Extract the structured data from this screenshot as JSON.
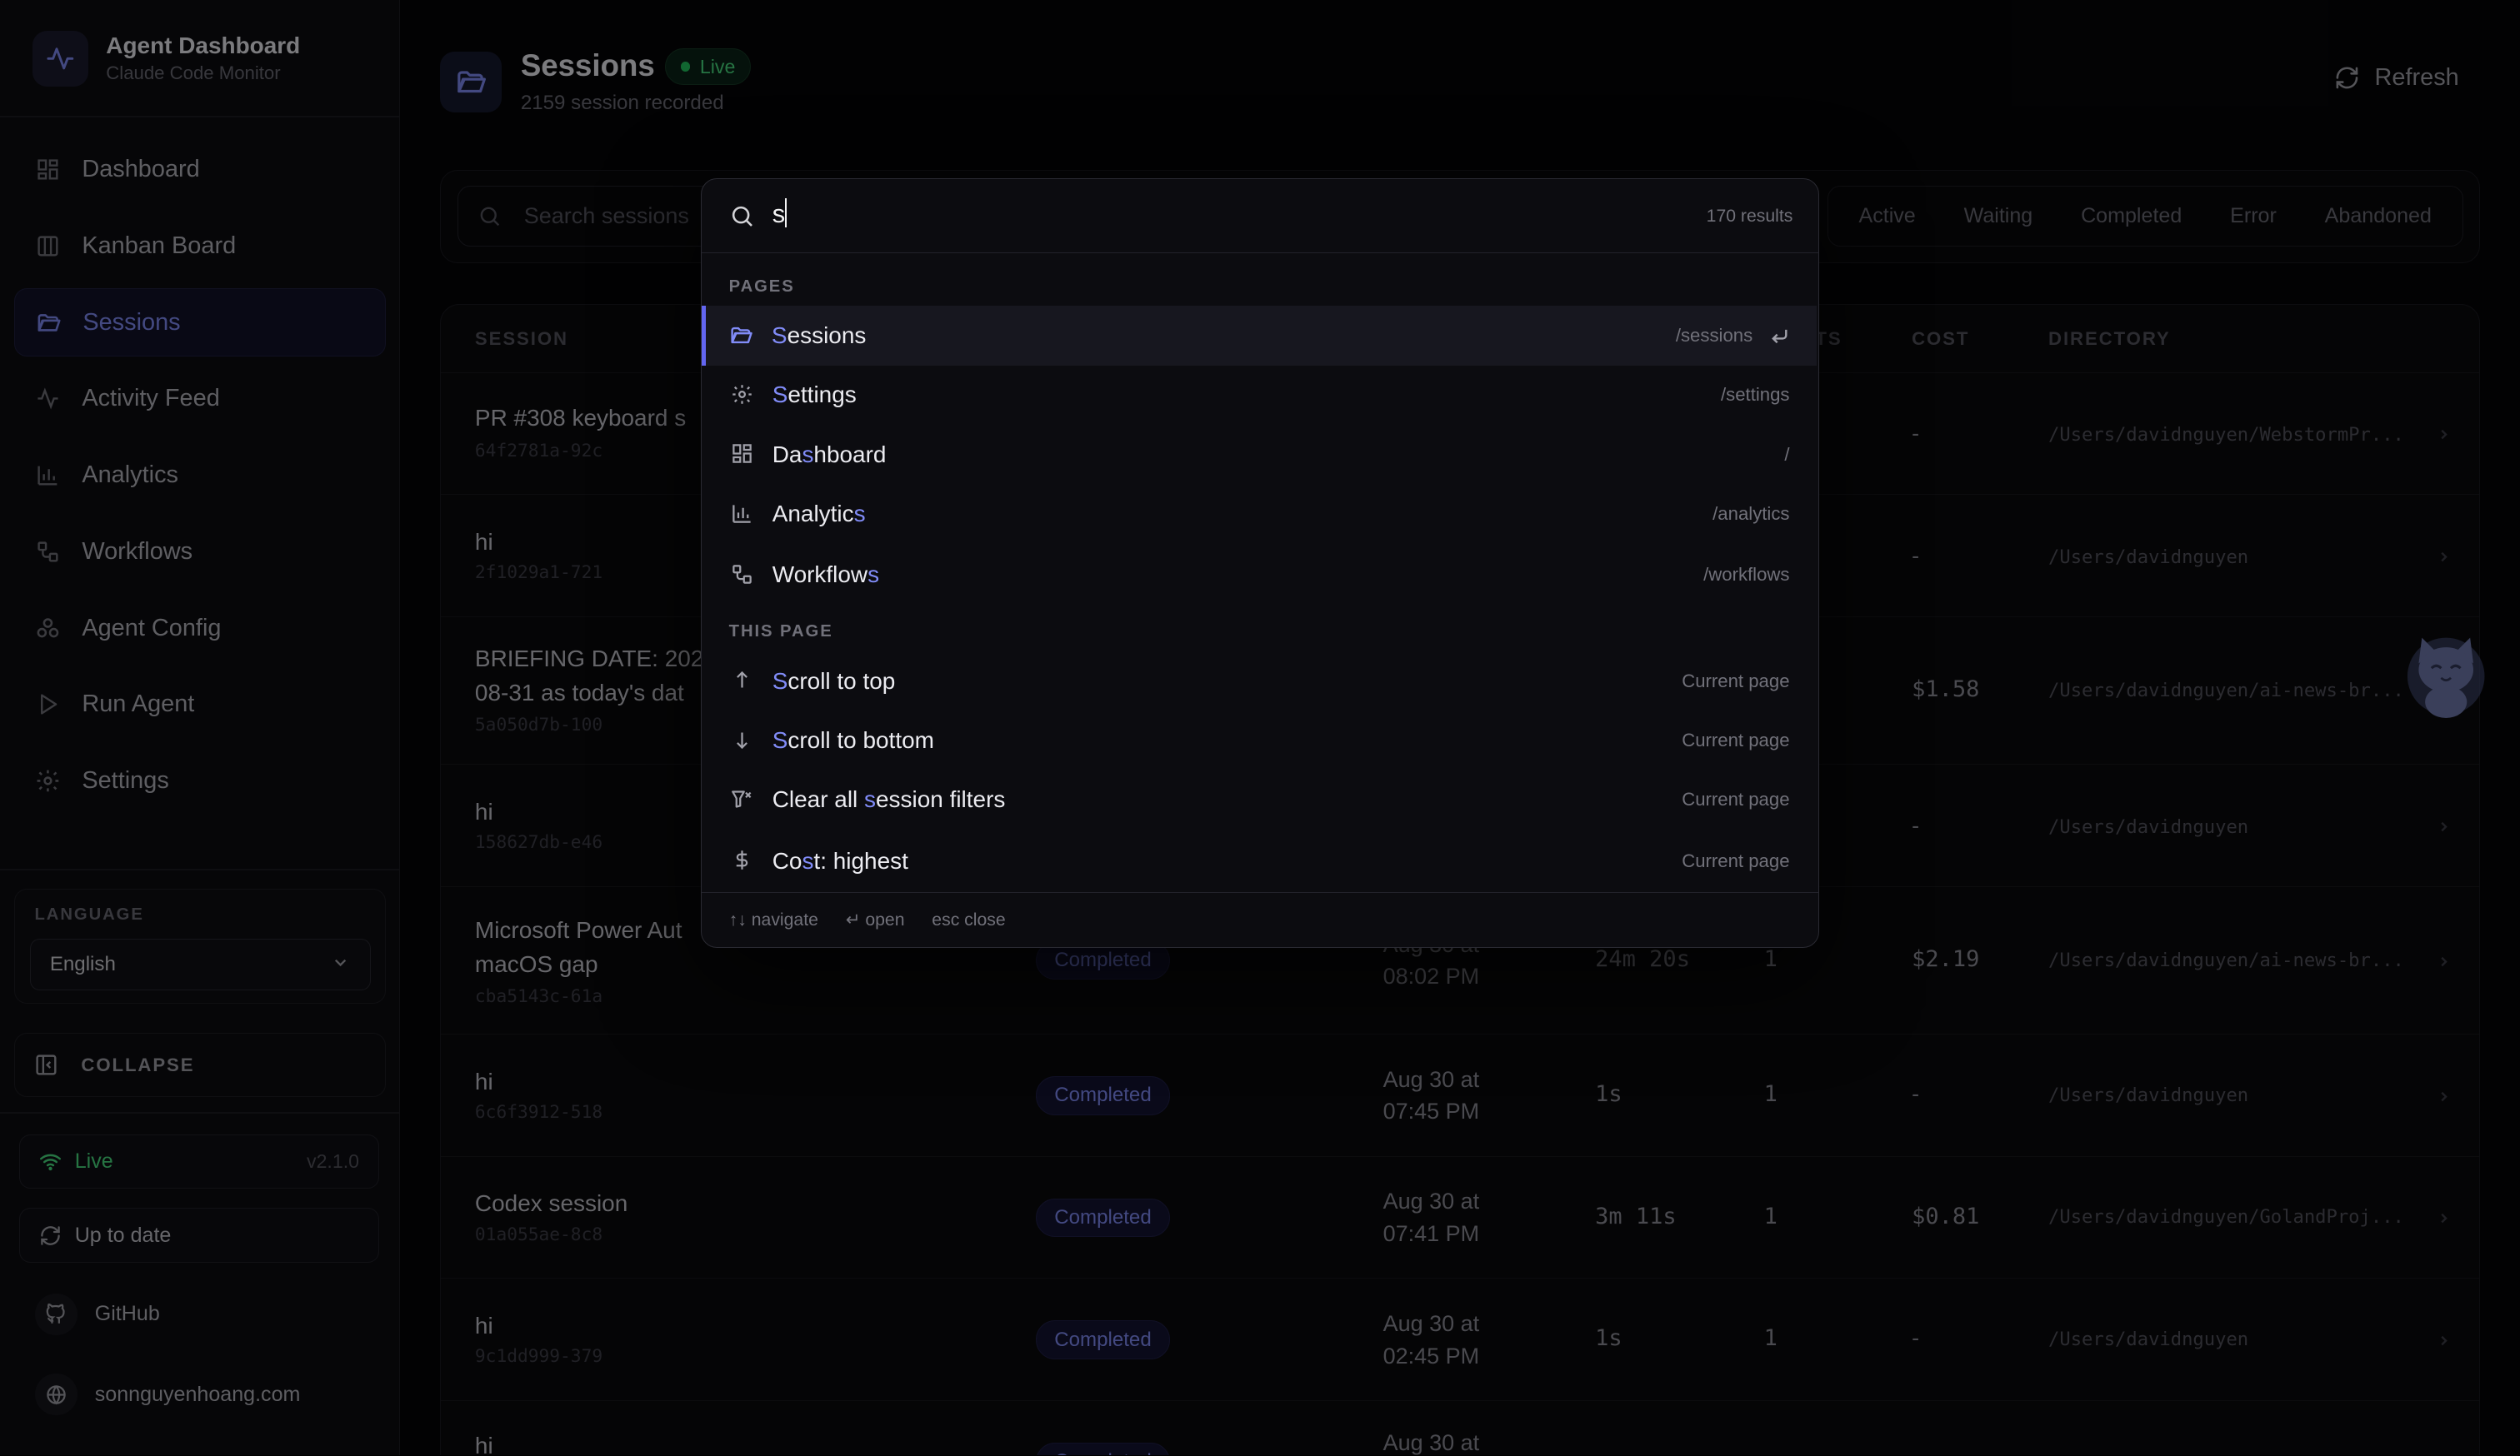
{
  "brand": {
    "title": "Agent Dashboard",
    "subtitle": "Claude Code Monitor"
  },
  "nav": [
    {
      "label": "Dashboard",
      "icon": "grid-icon"
    },
    {
      "label": "Kanban Board",
      "icon": "kanban-icon"
    },
    {
      "label": "Sessions",
      "icon": "folder-open-icon",
      "active": true
    },
    {
      "label": "Activity Feed",
      "icon": "activity-icon"
    },
    {
      "label": "Analytics",
      "icon": "bar-chart-icon"
    },
    {
      "label": "Workflows",
      "icon": "workflow-icon"
    },
    {
      "label": "Agent Config",
      "icon": "agents-icon"
    },
    {
      "label": "Run Agent",
      "icon": "play-icon"
    },
    {
      "label": "Settings",
      "icon": "gear-icon"
    }
  ],
  "language": {
    "label": "LANGUAGE",
    "selected": "English"
  },
  "collapse_label": "COLLAPSE",
  "status": {
    "live_label": "Live",
    "version": "v2.1.0",
    "update_label": "Up to date"
  },
  "links": {
    "github": "GitHub",
    "website": "sonnguyenhoang.com"
  },
  "page": {
    "title": "Sessions",
    "badge": "Live",
    "subtitle": "2159 session recorded",
    "refresh_label": "Refresh"
  },
  "filters": {
    "search_placeholder": "Search sessions",
    "tabs": [
      "Active",
      "Waiting",
      "Completed",
      "Error",
      "Abandoned"
    ]
  },
  "table": {
    "columns": {
      "session": "SESSION",
      "turns": "TS",
      "cost": "COST",
      "directory": "DIRECTORY"
    },
    "rows": [
      {
        "title": "PR #308 keyboard s",
        "id": "64f2781a-92c",
        "status": "",
        "date1": "",
        "date2": "",
        "duration": "",
        "turns": "",
        "cost": "-",
        "dir": "/Users/davidnguyen/WebstormPr..."
      },
      {
        "title": "hi",
        "id": "2f1029a1-721",
        "status": "",
        "date1": "",
        "date2": "",
        "duration": "",
        "turns": "",
        "cost": "-",
        "dir": "/Users/davidnguyen"
      },
      {
        "title": "BRIEFING DATE: 202",
        "title2": "08-31 as today's dat",
        "id": "5a050d7b-100",
        "status": "",
        "date1": "",
        "date2": "",
        "duration": "",
        "turns": "",
        "cost": "$1.58",
        "dir": "/Users/davidnguyen/ai-news-br..."
      },
      {
        "title": "hi",
        "id": "158627db-e46",
        "status": "",
        "date1": "",
        "date2": "",
        "duration": "",
        "turns": "",
        "cost": "-",
        "dir": "/Users/davidnguyen"
      },
      {
        "title": "Microsoft Power Aut",
        "title2": "macOS gap",
        "id": "cba5143c-61a",
        "status": "Completed",
        "date1": "Aug 30 at",
        "date2": "08:02 PM",
        "duration": "24m 20s",
        "turns": "1",
        "cost": "$2.19",
        "dir": "/Users/davidnguyen/ai-news-br..."
      },
      {
        "title": "hi",
        "id": "6c6f3912-518",
        "status": "Completed",
        "date1": "Aug 30 at",
        "date2": "07:45 PM",
        "duration": "1s",
        "turns": "1",
        "cost": "-",
        "dir": "/Users/davidnguyen"
      },
      {
        "title": "Codex session",
        "id": "01a055ae-8c8",
        "status": "Completed",
        "date1": "Aug 30 at",
        "date2": "07:41 PM",
        "duration": "3m 11s",
        "turns": "1",
        "cost": "$0.81",
        "dir": "/Users/davidnguyen/GolandProj..."
      },
      {
        "title": "hi",
        "id": "9c1dd999-379",
        "status": "Completed",
        "date1": "Aug 30 at",
        "date2": "02:45 PM",
        "duration": "1s",
        "turns": "1",
        "cost": "-",
        "dir": "/Users/davidnguyen"
      },
      {
        "title": "hi",
        "id": "",
        "status": "Completed",
        "date1": "Aug 30 at",
        "date2": "",
        "duration": "",
        "turns": "",
        "cost": "",
        "dir": ""
      }
    ]
  },
  "palette": {
    "query": "s",
    "result_count": "170 results",
    "sections": {
      "pages": "PAGES",
      "this_page": "THIS PAGE"
    },
    "pages": [
      {
        "label": "Sessions",
        "pre": "",
        "match": "S",
        "post": "essions",
        "hint": "/sessions",
        "icon": "folder-open-icon",
        "selected": true
      },
      {
        "label": "Settings",
        "pre": "",
        "match": "S",
        "post": "ettings",
        "hint": "/settings",
        "icon": "gear-icon"
      },
      {
        "label": "Dashboard",
        "pre": "Da",
        "match": "s",
        "post": "hboard",
        "hint": "/",
        "icon": "grid-icon"
      },
      {
        "label": "Analytics",
        "pre": "Analytic",
        "match": "s",
        "post": "",
        "hint": "/analytics",
        "icon": "bar-chart-icon"
      },
      {
        "label": "Workflows",
        "pre": "Workflow",
        "match": "s",
        "post": "",
        "hint": "/workflows",
        "icon": "workflow-icon"
      }
    ],
    "actions": [
      {
        "label": "Scroll to top",
        "pre": "",
        "match": "S",
        "post": "croll to top",
        "hint": "Current page",
        "icon": "arrow-up-icon"
      },
      {
        "label": "Scroll to bottom",
        "pre": "",
        "match": "S",
        "post": "croll to bottom",
        "hint": "Current page",
        "icon": "arrow-down-icon"
      },
      {
        "label": "Clear all session filters",
        "pre": "Clear all ",
        "match": "s",
        "post": "ession filters",
        "hint": "Current page",
        "icon": "filter-x-icon"
      },
      {
        "label": "Cost: highest",
        "pre": "Co",
        "match": "s",
        "post": "t: highest",
        "hint": "Current page",
        "icon": "dollar-icon"
      }
    ],
    "footer": {
      "navigate": "↑↓ navigate",
      "open": "↵ open",
      "close": "esc close"
    }
  },
  "colors": {
    "accent": "#818cf8",
    "live": "#4ade80",
    "background": "#050507"
  }
}
